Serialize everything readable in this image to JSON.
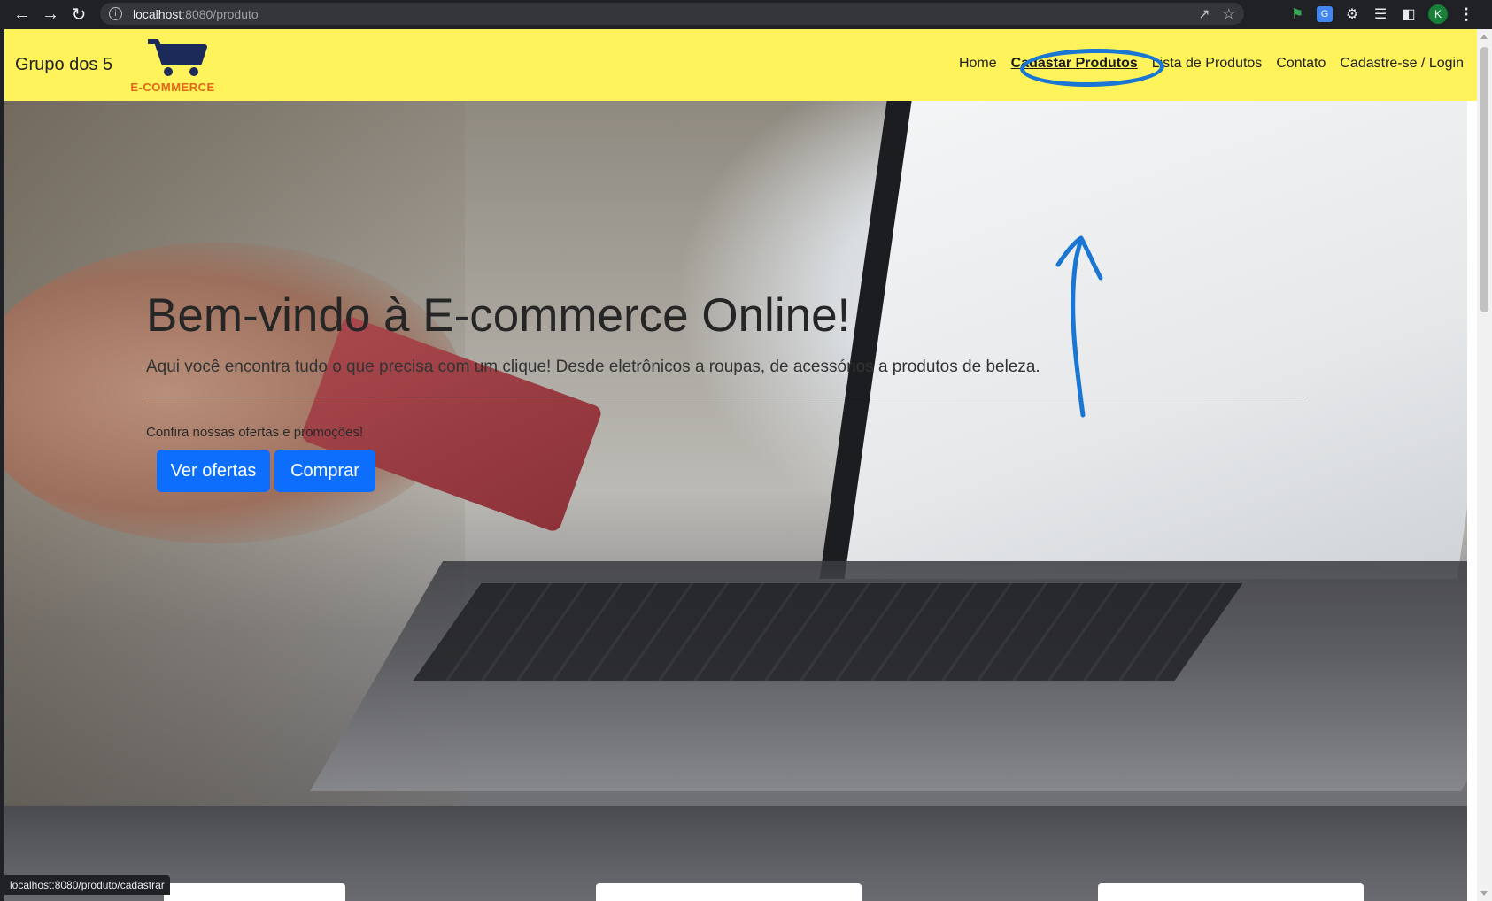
{
  "browser": {
    "url_host": "localhost",
    "url_path": ":8080/produto",
    "profile_initial": "K",
    "status_url": "localhost:8080/produto/cadastrar"
  },
  "navbar": {
    "brand": "Grupo dos 5",
    "logo_text": "E-COMMERCE",
    "links": [
      {
        "label": "Home"
      },
      {
        "label": "Cadastar Produtos"
      },
      {
        "label": "Lista de Produtos"
      },
      {
        "label": "Contato"
      },
      {
        "label": "Cadastre-se / Login"
      }
    ]
  },
  "hero": {
    "title": "Bem-vindo à E-commerce Online!",
    "subtitle": "Aqui você encontra tudo o que precisa com um clique! Desde eletrônicos a roupas, de acessórios a produtos de beleza.",
    "promo": "Confira nossas ofertas e promoções!",
    "btn_ofertas": "Ver ofertas",
    "btn_comprar": "Comprar"
  },
  "colors": {
    "navbar_bg": "#fff35c",
    "primary_button": "#0d6efd",
    "annotation": "#1976d2",
    "logo_orange": "#e0671b",
    "logo_navy": "#1c2a5a"
  }
}
